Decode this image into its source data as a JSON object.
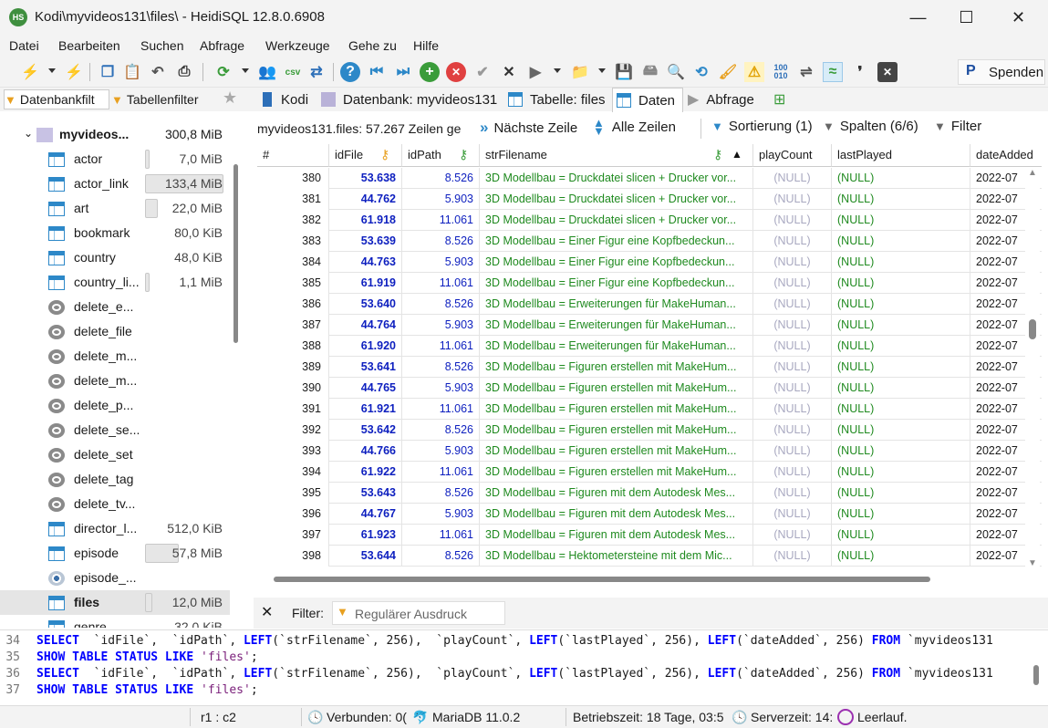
{
  "window": {
    "title": "Kodi\\myvideos131\\files\\ - HeidiSQL 12.8.0.6908",
    "logo_text": "HS",
    "minimize_label": "—",
    "maximize_label": "☐",
    "close_label": "✕"
  },
  "menu": [
    "Datei",
    "Bearbeiten",
    "Suchen",
    "Abfrage",
    "Werkzeuge",
    "Gehe zu",
    "Hilfe"
  ],
  "toolbar": {
    "donate_label": "Spenden",
    "icons": [
      "connect-icon",
      "disconnect-icon",
      "copy-icon",
      "paste-icon",
      "undo-icon",
      "print-icon",
      "refresh-icon",
      "user-manager-icon",
      "export-csv-icon",
      "sync-icon",
      "help-icon",
      "first-icon",
      "last-icon",
      "add-icon",
      "delete-icon",
      "post-icon",
      "cancel-icon",
      "run-icon",
      "open-folder-icon",
      "save-icon",
      "save-as-icon",
      "search-icon",
      "replace-icon",
      "beautify-icon",
      "warning-icon",
      "binary-icon",
      "wrap-icon",
      "format-icon",
      "comment-icon",
      "close-tab-icon"
    ]
  },
  "left_panel": {
    "tab_db_filter": "Datenbankfilt",
    "tab_table_filter": "Tabellenfilter",
    "database": {
      "name": "myvideos...",
      "size": "300,8 MiB"
    },
    "items": [
      {
        "name": "actor",
        "size": "7,0 MiB",
        "type": "table",
        "fill": 0.02
      },
      {
        "name": "actor_link",
        "size": "133,4 MiB",
        "type": "table",
        "fill": 1.0
      },
      {
        "name": "art",
        "size": "22,0 MiB",
        "type": "table",
        "fill": 0.16
      },
      {
        "name": "bookmark",
        "size": "80,0 KiB",
        "type": "table",
        "fill": 0
      },
      {
        "name": "country",
        "size": "48,0 KiB",
        "type": "table",
        "fill": 0
      },
      {
        "name": "country_li...",
        "size": "1,1 MiB",
        "type": "table",
        "fill": 0.01
      },
      {
        "name": "delete_e...",
        "size": "",
        "type": "trigger",
        "fill": 0
      },
      {
        "name": "delete_file",
        "size": "",
        "type": "trigger",
        "fill": 0
      },
      {
        "name": "delete_m...",
        "size": "",
        "type": "trigger",
        "fill": 0
      },
      {
        "name": "delete_m...",
        "size": "",
        "type": "trigger",
        "fill": 0
      },
      {
        "name": "delete_p...",
        "size": "",
        "type": "trigger",
        "fill": 0
      },
      {
        "name": "delete_se...",
        "size": "",
        "type": "trigger",
        "fill": 0
      },
      {
        "name": "delete_set",
        "size": "",
        "type": "trigger",
        "fill": 0
      },
      {
        "name": "delete_tag",
        "size": "",
        "type": "trigger",
        "fill": 0
      },
      {
        "name": "delete_tv...",
        "size": "",
        "type": "trigger",
        "fill": 0
      },
      {
        "name": "director_l...",
        "size": "512,0 KiB",
        "type": "table",
        "fill": 0
      },
      {
        "name": "episode",
        "size": "57,8 MiB",
        "type": "table",
        "fill": 0.43
      },
      {
        "name": "episode_...",
        "size": "",
        "type": "view",
        "fill": 0
      },
      {
        "name": "files",
        "size": "12,0 MiB",
        "type": "table",
        "fill": 0.09,
        "selected": true
      },
      {
        "name": "genre",
        "size": "32,0 KiB",
        "type": "table",
        "fill": 0
      }
    ]
  },
  "tabs": [
    {
      "label": "Kodi",
      "icon": "server-icon"
    },
    {
      "label": "Datenbank: myvideos131",
      "icon": "database-icon"
    },
    {
      "label": "Tabelle: files",
      "icon": "table-icon"
    },
    {
      "label": "Daten",
      "icon": "grid-icon",
      "active": true
    },
    {
      "label": "Abfrage",
      "icon": "play-icon"
    }
  ],
  "data_toolbar": {
    "row_info": "myvideos131.files: 57.267 Zeilen ge",
    "next_row": "Nächste Zeile",
    "all_rows": "Alle Zeilen",
    "sorting": "Sortierung (1)",
    "columns": "Spalten (6/6)",
    "filter": "Filter"
  },
  "grid": {
    "columns": [
      "#",
      "idFile",
      "idPath",
      "strFilename",
      "playCount",
      "lastPlayed",
      "dateAdded"
    ],
    "rows": [
      [
        "380",
        "53.638",
        "8.526",
        "3D Modellbau = Druckdatei slicen + Drucker vor...",
        "(NULL)",
        "(NULL)",
        "2022-07"
      ],
      [
        "381",
        "44.762",
        "5.903",
        "3D Modellbau = Druckdatei slicen + Drucker vor...",
        "(NULL)",
        "(NULL)",
        "2022-07"
      ],
      [
        "382",
        "61.918",
        "11.061",
        "3D Modellbau = Druckdatei slicen + Drucker vor...",
        "(NULL)",
        "(NULL)",
        "2022-07"
      ],
      [
        "383",
        "53.639",
        "8.526",
        "3D Modellbau = Einer Figur eine Kopfbedeckun...",
        "(NULL)",
        "(NULL)",
        "2022-07"
      ],
      [
        "384",
        "44.763",
        "5.903",
        "3D Modellbau = Einer Figur eine Kopfbedeckun...",
        "(NULL)",
        "(NULL)",
        "2022-07"
      ],
      [
        "385",
        "61.919",
        "11.061",
        "3D Modellbau = Einer Figur eine Kopfbedeckun...",
        "(NULL)",
        "(NULL)",
        "2022-07"
      ],
      [
        "386",
        "53.640",
        "8.526",
        "3D Modellbau = Erweiterungen für MakeHuman...",
        "(NULL)",
        "(NULL)",
        "2022-07"
      ],
      [
        "387",
        "44.764",
        "5.903",
        "3D Modellbau = Erweiterungen für MakeHuman...",
        "(NULL)",
        "(NULL)",
        "2022-07"
      ],
      [
        "388",
        "61.920",
        "11.061",
        "3D Modellbau = Erweiterungen für MakeHuman...",
        "(NULL)",
        "(NULL)",
        "2022-07"
      ],
      [
        "389",
        "53.641",
        "8.526",
        "3D Modellbau = Figuren erstellen mit MakeHum...",
        "(NULL)",
        "(NULL)",
        "2022-07"
      ],
      [
        "390",
        "44.765",
        "5.903",
        "3D Modellbau = Figuren erstellen mit MakeHum...",
        "(NULL)",
        "(NULL)",
        "2022-07"
      ],
      [
        "391",
        "61.921",
        "11.061",
        "3D Modellbau = Figuren erstellen mit MakeHum...",
        "(NULL)",
        "(NULL)",
        "2022-07"
      ],
      [
        "392",
        "53.642",
        "8.526",
        "3D Modellbau = Figuren erstellen mit MakeHum...",
        "(NULL)",
        "(NULL)",
        "2022-07"
      ],
      [
        "393",
        "44.766",
        "5.903",
        "3D Modellbau = Figuren erstellen mit MakeHum...",
        "(NULL)",
        "(NULL)",
        "2022-07"
      ],
      [
        "394",
        "61.922",
        "11.061",
        "3D Modellbau = Figuren erstellen mit MakeHum...",
        "(NULL)",
        "(NULL)",
        "2022-07"
      ],
      [
        "395",
        "53.643",
        "8.526",
        "3D Modellbau = Figuren mit dem Autodesk Mes...",
        "(NULL)",
        "(NULL)",
        "2022-07"
      ],
      [
        "396",
        "44.767",
        "5.903",
        "3D Modellbau = Figuren mit dem Autodesk Mes...",
        "(NULL)",
        "(NULL)",
        "2022-07"
      ],
      [
        "397",
        "61.923",
        "11.061",
        "3D Modellbau = Figuren mit dem Autodesk Mes...",
        "(NULL)",
        "(NULL)",
        "2022-07"
      ],
      [
        "398",
        "53.644",
        "8.526",
        "3D Modellbau = Hektometersteine mit dem Mic...",
        "(NULL)",
        "(NULL)",
        "2022-07"
      ]
    ]
  },
  "filter_bar": {
    "close_label": "✕",
    "label": "Filter:",
    "placeholder": "Regulärer Ausdruck"
  },
  "sql_log": [
    {
      "line": "34",
      "text": "SELECT  `idFile`,  `idPath`, LEFT(`strFilename`, 256),  `playCount`, LEFT(`lastPlayed`, 256), LEFT(`dateAdded`, 256) FROM `myvideos131"
    },
    {
      "line": "35",
      "text": "SHOW TABLE STATUS LIKE 'files';"
    },
    {
      "line": "36",
      "text": "SELECT  `idFile`,  `idPath`, LEFT(`strFilename`, 256),  `playCount`, LEFT(`lastPlayed`, 256), LEFT(`dateAdded`, 256) FROM `myvideos131"
    },
    {
      "line": "37",
      "text": "SHOW TABLE STATUS LIKE 'files';"
    }
  ],
  "status": {
    "position": "r1 : c2",
    "connected": "Verbunden: 0(",
    "server": "MariaDB 11.0.2",
    "uptime": "Betriebszeit: 18 Tage, 03:5",
    "server_time": "Serverzeit: 14:",
    "idle": "Leerlauf."
  },
  "colors": {
    "accent_blue": "#2d88c8",
    "id_blue": "#0d1fbf",
    "text_green": "#1f8a1f",
    "null_gray": "#a8a8c0"
  }
}
